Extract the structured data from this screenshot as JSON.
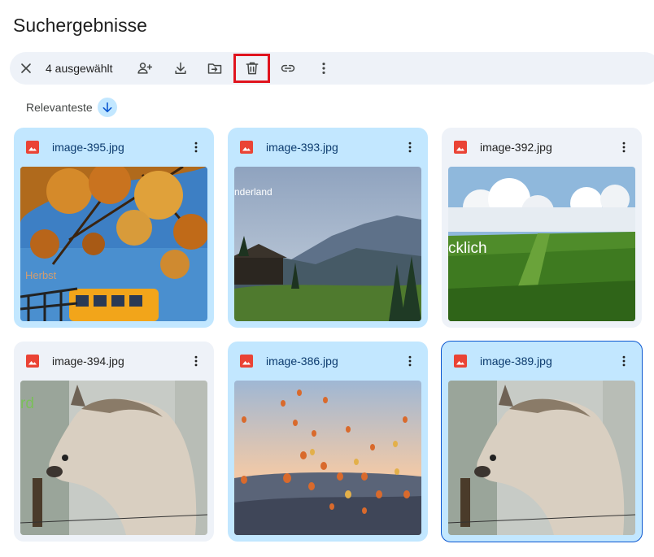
{
  "page": {
    "title": "Suchergebnisse"
  },
  "toolbar": {
    "selection_count": "4 ausgewählt",
    "buttons": [
      "close-icon",
      "share-icon",
      "download-icon",
      "move-icon",
      "trash-icon",
      "link-icon",
      "more-vert-icon"
    ]
  },
  "sort": {
    "label": "Relevanteste",
    "direction": "descending"
  },
  "files": [
    {
      "name": "image-395.jpg",
      "selected": true,
      "thumb_caption": "Herbst"
    },
    {
      "name": "image-393.jpg",
      "selected": true,
      "thumb_caption": "nderland"
    },
    {
      "name": "image-392.jpg",
      "selected": false,
      "thumb_caption": "cklich"
    },
    {
      "name": "image-394.jpg",
      "selected": false,
      "thumb_caption": "rd"
    },
    {
      "name": "image-386.jpg",
      "selected": true,
      "thumb_caption": ""
    },
    {
      "name": "image-389.jpg",
      "selected": true,
      "thumb_caption": ""
    }
  ],
  "colors": {
    "accent": "#0b57d0",
    "selected_card": "#c2e7ff",
    "card": "#eef2f8",
    "highlight": "#e0141e",
    "image_icon": "#ea4335"
  }
}
